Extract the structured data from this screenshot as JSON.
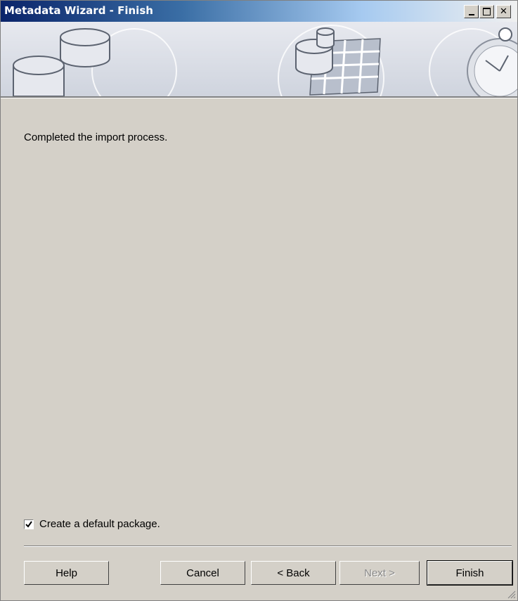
{
  "window": {
    "title": "Metadata Wizard - Finish"
  },
  "titlebar_buttons": [
    "minimize",
    "maximize",
    "close"
  ],
  "body": {
    "message": "Completed the import process."
  },
  "checkbox": {
    "label": "Create a default package.",
    "checked": true
  },
  "buttons": {
    "help": "Help",
    "cancel": "Cancel",
    "back": "< Back",
    "next": "Next >",
    "finish": "Finish"
  },
  "colors": {
    "face": "#d4d0c8",
    "title_start": "#0a246a",
    "title_end": "#a6caf0"
  }
}
